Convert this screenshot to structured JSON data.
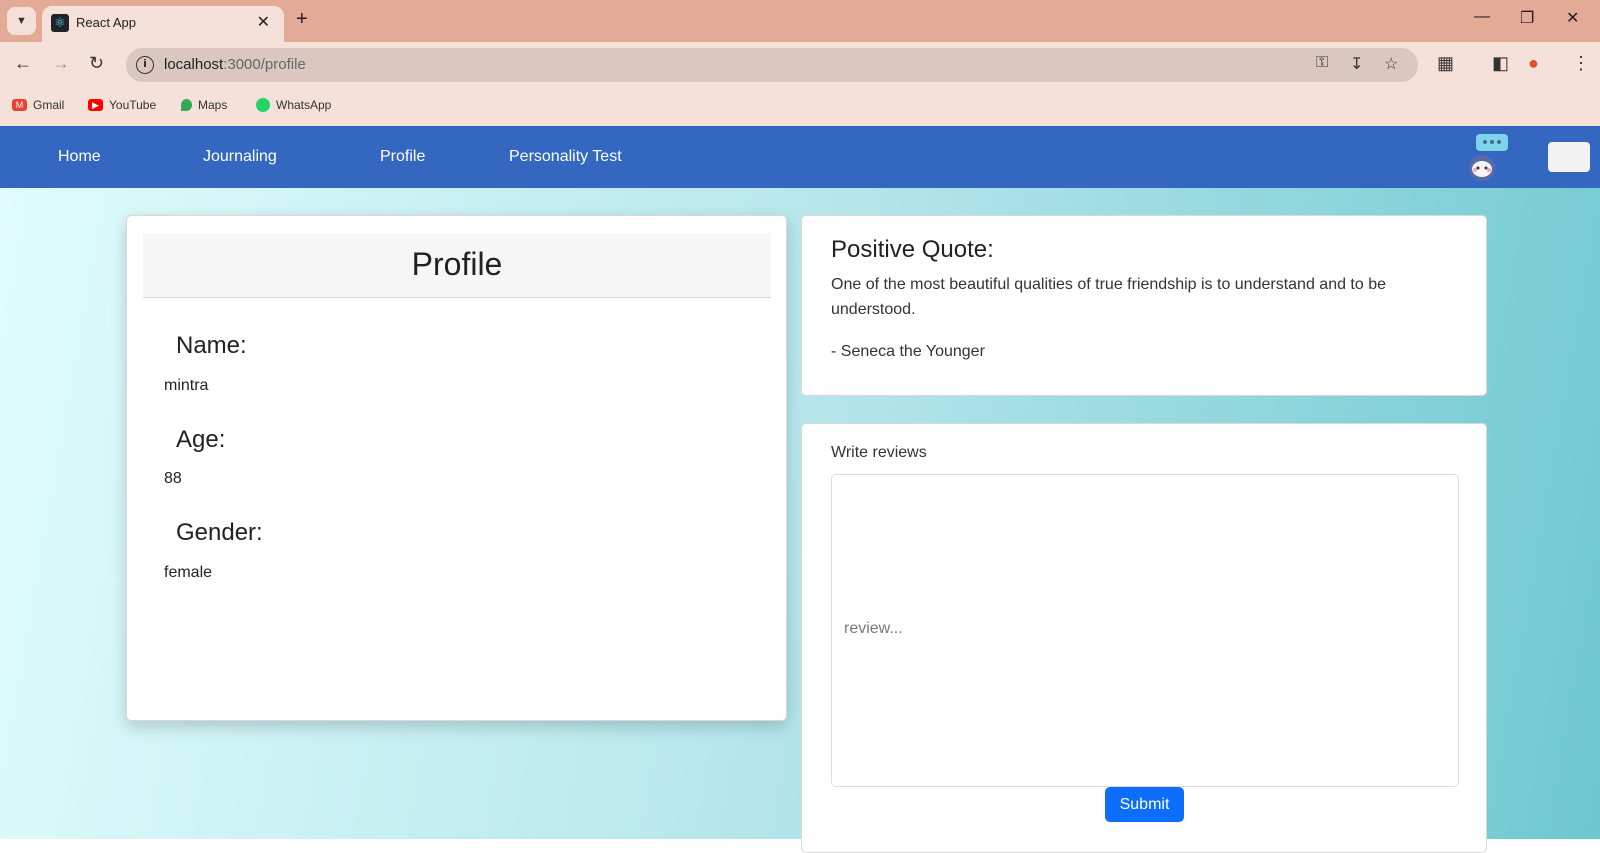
{
  "browser": {
    "tab_title": "React App",
    "url_host": "localhost",
    "url_path": ":3000/profile",
    "bookmarks": [
      {
        "label": "Gmail",
        "color": "#ea4335"
      },
      {
        "label": "YouTube",
        "color": "#ff0000"
      },
      {
        "label": "Maps",
        "color": "#34a853"
      },
      {
        "label": "WhatsApp",
        "color": "#25d366"
      }
    ]
  },
  "nav": {
    "items": [
      {
        "label": "Home"
      },
      {
        "label": "Journaling"
      },
      {
        "label": "Profile"
      },
      {
        "label": "Personality Test"
      }
    ],
    "brand_color": "#3367c0"
  },
  "profile": {
    "title": "Profile",
    "name_label": "Name:",
    "name": "mintra",
    "age_label": "Age:",
    "age": "88",
    "gender_label": "Gender:",
    "gender": "female"
  },
  "quote": {
    "title": "Positive Quote:",
    "text": "One of the most beautiful qualities of true friendship is to understand and to be understood.",
    "author": "- Seneca the Younger"
  },
  "review": {
    "label": "Write reviews",
    "placeholder": "review...",
    "value": "",
    "submit_label": "Submit",
    "submit_color": "#0d6efd"
  }
}
